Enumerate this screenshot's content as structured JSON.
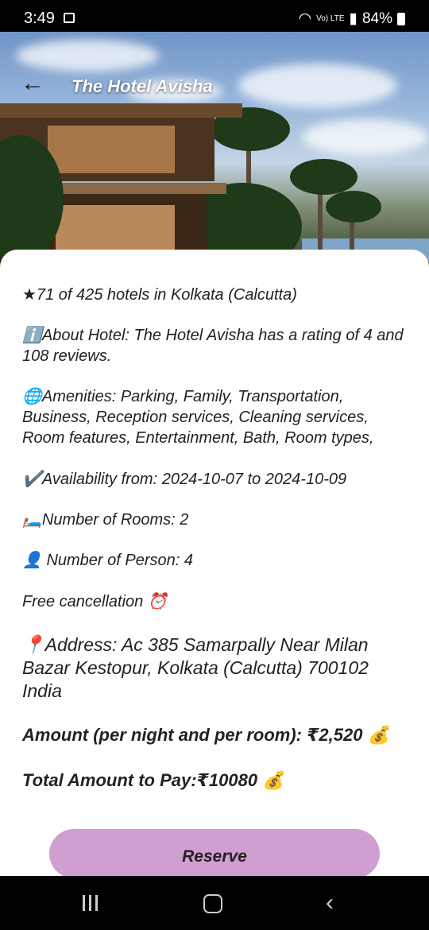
{
  "status": {
    "time": "3:49",
    "network": "Vo) LTE",
    "battery": "84%"
  },
  "header": {
    "title": "The Hotel Avisha"
  },
  "details": {
    "rank": "★71 of 425 hotels in Kolkata (Calcutta)",
    "about": "ℹ️About Hotel: The Hotel Avisha has a rating of 4 and 108 reviews.",
    "amenities": "🌐Amenities: Parking, Family, Transportation, Business, Reception services, Cleaning services, Room features, Entertainment, Bath, Room types,",
    "availability": "✔️Availability from: 2024-10-07 to 2024-10-09",
    "rooms": "🛏️Number of Rooms: 2",
    "persons": "👤 Number of Person: 4",
    "cancellation": "Free cancellation ⏰",
    "address": "📍Address: Ac 385 Samarpally Near Milan Bazar Kestopur, Kolkata (Calcutta) 700102 India",
    "amount": "Amount (per night and per room): ₹2,520 💰",
    "total": "Total Amount to Pay:₹10080 💰"
  },
  "actions": {
    "reserve_label": "Reserve"
  },
  "colors": {
    "reserve_bg": "#cf9fd1"
  }
}
